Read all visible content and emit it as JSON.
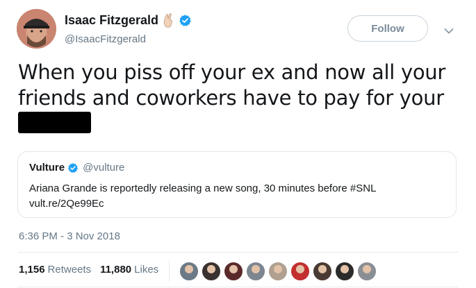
{
  "author": {
    "name": "Isaac Fitzgerald",
    "handle": "@IsaacFitzgerald",
    "verified": true,
    "emoji_icon": "crossed-fingers-icon"
  },
  "follow_button": {
    "label": "Follow"
  },
  "tweet": {
    "text": "When you piss off your ex and now all your friends and coworkers have to pay for your"
  },
  "quoted_tweet": {
    "name": "Vulture",
    "handle": "@vulture",
    "verified": true,
    "text": "Ariana Grande is reportedly releasing a new song, 30 minutes before #SNL",
    "link": "vult.re/2Qe99Ec"
  },
  "timestamp": "6:36 PM - 3 Nov 2018",
  "stats": {
    "retweets_count": "1,156",
    "retweets_label": "Retweets",
    "likes_count": "11,880",
    "likes_label": "Likes"
  },
  "colors": {
    "verified_blue": "#1da1f2",
    "text_primary": "#14171a",
    "text_secondary": "#657786",
    "border": "#e6ecf0"
  },
  "liker_avatars": [
    {
      "color": "#6b7a86"
    },
    {
      "color": "#3a3230"
    },
    {
      "color": "#5a2a2a"
    },
    {
      "color": "#7d8690"
    },
    {
      "color": "#b0a090"
    },
    {
      "color": "#c22f2f"
    },
    {
      "color": "#4a3a34"
    },
    {
      "color": "#2b2b2b"
    },
    {
      "color": "#8a8f96"
    }
  ]
}
